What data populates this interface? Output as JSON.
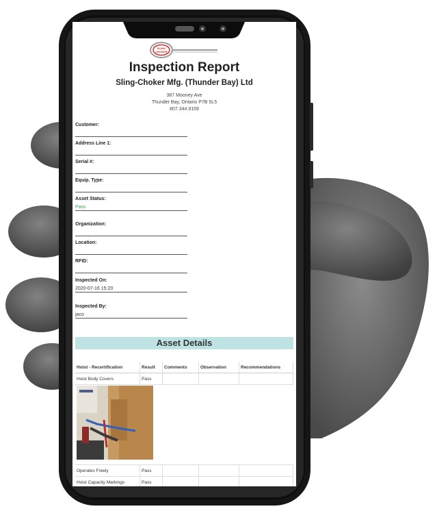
{
  "report": {
    "title": "Inspection Report",
    "company": "Sling-Choker Mfg. (Thunder Bay) Ltd",
    "address_line1": "387 Mooney Ave",
    "address_line2": "Thunder Bay, Ontario P7B 5L5",
    "phone": "807.344.9159",
    "logo_text_line1": "SLING",
    "logo_text_line2": "CHOKER"
  },
  "fields": [
    {
      "label": "Customer:",
      "value": ""
    },
    {
      "label": "Address Line 1:",
      "value": ""
    },
    {
      "label": "Serial #:",
      "value": ""
    },
    {
      "label": "Equip. Type:",
      "value": ""
    },
    {
      "label": "Asset Status:",
      "value": "Pass"
    },
    {
      "label": "Organization:",
      "value": ""
    },
    {
      "label": "Location:",
      "value": ""
    },
    {
      "label": "RFID:",
      "value": ""
    },
    {
      "label": "Inspected On:",
      "value": "2020-07-16 15:20"
    },
    {
      "label": "Inspected By:",
      "value": "jaco"
    }
  ],
  "asset_details": {
    "heading": "Asset Details",
    "columns": [
      "Hoist - Recertification",
      "Result",
      "Comments",
      "Observation",
      "Recommendations"
    ],
    "rows": [
      [
        "Hoist Body Covers",
        "Pass",
        "",
        "",
        ""
      ],
      [
        "Operates Freely",
        "Pass",
        "",
        "",
        ""
      ],
      [
        "Hoist Capacity Markings",
        "Pass",
        "",
        "",
        ""
      ]
    ]
  },
  "colors": {
    "pass_green": "#3aa757",
    "section_bg": "#bfe3e3",
    "glove_grey": "#6f6f6f",
    "phone_black": "#161616",
    "logo_red": "#d22a2a"
  }
}
